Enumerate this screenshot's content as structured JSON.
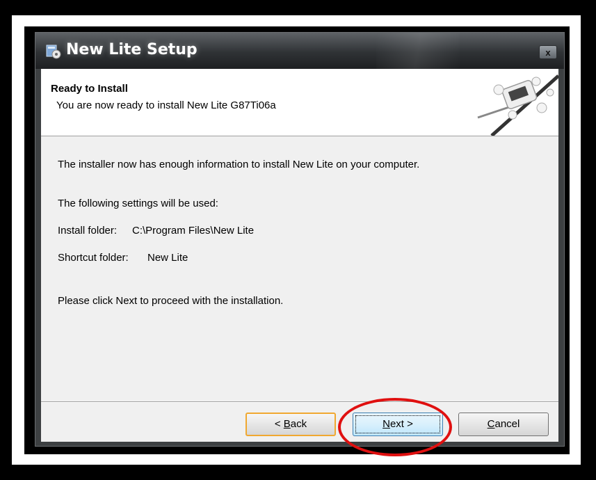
{
  "window": {
    "title": "New Lite Setup",
    "close_glyph": "x",
    "app_icon": "installer-icon"
  },
  "header": {
    "title": "Ready to Install",
    "subtitle": "You are now ready to install New Lite G87Ti06a",
    "image": "installer-banner-graphic"
  },
  "content": {
    "intro": "The installer now has enough information to install New Lite on your computer.",
    "settings_heading": "The following settings will be used:",
    "install_folder_label": "Install folder:",
    "install_folder_value": "C:\\Program Files\\New Lite",
    "shortcut_folder_label": "Shortcut folder:",
    "shortcut_folder_value": "New Lite",
    "instruction": "Please click Next to proceed with the installation."
  },
  "buttons": {
    "back_prefix": "< ",
    "back_key": "B",
    "back_rest": "ack",
    "next_key": "N",
    "next_rest": "ext >",
    "cancel_key": "C",
    "cancel_rest": "ancel"
  },
  "annotation": {
    "color": "#e01010",
    "target": "next-button"
  }
}
